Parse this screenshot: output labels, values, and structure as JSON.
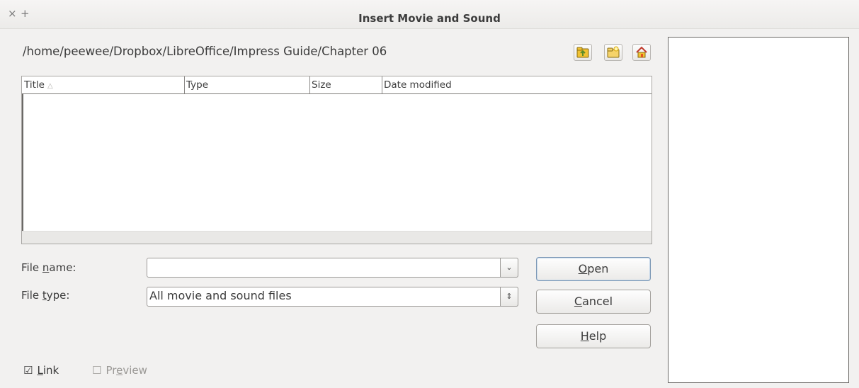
{
  "window": {
    "title": "Insert Movie and Sound",
    "close_glyph": "×",
    "add_glyph": "+"
  },
  "path": "/home/peewee/Dropbox/LibreOffice/Impress Guide/Chapter 06",
  "toolbar": {
    "icons": [
      "folder-up-icon",
      "new-folder-icon",
      "home-icon"
    ]
  },
  "file_list": {
    "columns": [
      "Title",
      "Type",
      "Size",
      "Date modified"
    ],
    "sort_glyph": "△",
    "rows": []
  },
  "form": {
    "file_name_label_pre": "File ",
    "file_name_label_key": "n",
    "file_name_label_post": "ame:",
    "file_name_value": "",
    "file_type_label_pre": "File ",
    "file_type_label_key": "t",
    "file_type_label_post": "ype:",
    "file_type_value": "All movie and sound files",
    "file_name_dropdown_glyph": "⌄",
    "file_type_spinner_glyph": "⇕"
  },
  "buttons": {
    "open_key": "O",
    "open_rest": "pen",
    "cancel_key": "C",
    "cancel_rest": "ancel",
    "help_key": "H",
    "help_rest": "elp"
  },
  "options": {
    "link_checked": true,
    "link_glyph": "☑",
    "link_key": "L",
    "link_rest": "ink",
    "preview_checked": false,
    "preview_glyph": "☐",
    "preview_pre": "Pr",
    "preview_key": "e",
    "preview_rest": "view"
  },
  "colors": {
    "background": "#f2f1f0",
    "default_button_border": "#7b97b5",
    "folder_icon": "#f1c232",
    "home_icon": "#e2571e"
  }
}
